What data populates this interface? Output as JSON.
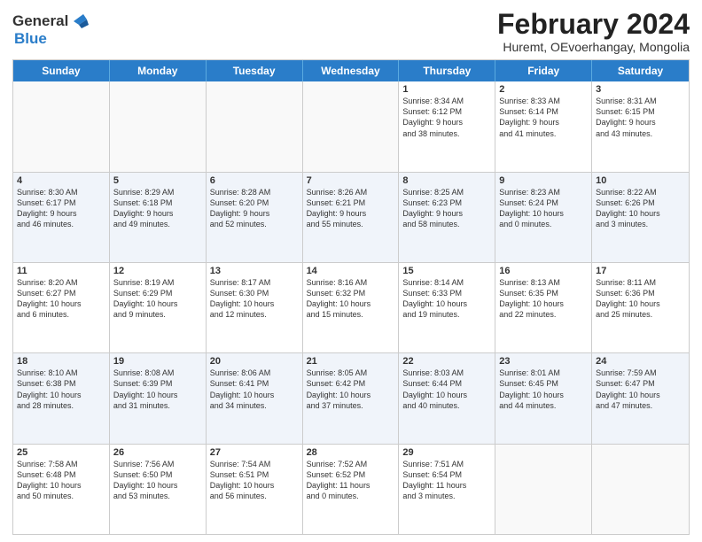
{
  "header": {
    "logo_general": "General",
    "logo_blue": "Blue",
    "main_title": "February 2024",
    "sub_title": "Huremt, OEvoerhangay, Mongolia"
  },
  "calendar": {
    "days_of_week": [
      "Sunday",
      "Monday",
      "Tuesday",
      "Wednesday",
      "Thursday",
      "Friday",
      "Saturday"
    ],
    "weeks": [
      {
        "cells": [
          {
            "day": "",
            "info": "",
            "empty": true
          },
          {
            "day": "",
            "info": "",
            "empty": true
          },
          {
            "day": "",
            "info": "",
            "empty": true
          },
          {
            "day": "",
            "info": "",
            "empty": true
          },
          {
            "day": "1",
            "info": "Sunrise: 8:34 AM\nSunset: 6:12 PM\nDaylight: 9 hours\nand 38 minutes.",
            "empty": false
          },
          {
            "day": "2",
            "info": "Sunrise: 8:33 AM\nSunset: 6:14 PM\nDaylight: 9 hours\nand 41 minutes.",
            "empty": false
          },
          {
            "day": "3",
            "info": "Sunrise: 8:31 AM\nSunset: 6:15 PM\nDaylight: 9 hours\nand 43 minutes.",
            "empty": false
          }
        ]
      },
      {
        "cells": [
          {
            "day": "4",
            "info": "Sunrise: 8:30 AM\nSunset: 6:17 PM\nDaylight: 9 hours\nand 46 minutes.",
            "empty": false
          },
          {
            "day": "5",
            "info": "Sunrise: 8:29 AM\nSunset: 6:18 PM\nDaylight: 9 hours\nand 49 minutes.",
            "empty": false
          },
          {
            "day": "6",
            "info": "Sunrise: 8:28 AM\nSunset: 6:20 PM\nDaylight: 9 hours\nand 52 minutes.",
            "empty": false
          },
          {
            "day": "7",
            "info": "Sunrise: 8:26 AM\nSunset: 6:21 PM\nDaylight: 9 hours\nand 55 minutes.",
            "empty": false
          },
          {
            "day": "8",
            "info": "Sunrise: 8:25 AM\nSunset: 6:23 PM\nDaylight: 9 hours\nand 58 minutes.",
            "empty": false
          },
          {
            "day": "9",
            "info": "Sunrise: 8:23 AM\nSunset: 6:24 PM\nDaylight: 10 hours\nand 0 minutes.",
            "empty": false
          },
          {
            "day": "10",
            "info": "Sunrise: 8:22 AM\nSunset: 6:26 PM\nDaylight: 10 hours\nand 3 minutes.",
            "empty": false
          }
        ]
      },
      {
        "cells": [
          {
            "day": "11",
            "info": "Sunrise: 8:20 AM\nSunset: 6:27 PM\nDaylight: 10 hours\nand 6 minutes.",
            "empty": false
          },
          {
            "day": "12",
            "info": "Sunrise: 8:19 AM\nSunset: 6:29 PM\nDaylight: 10 hours\nand 9 minutes.",
            "empty": false
          },
          {
            "day": "13",
            "info": "Sunrise: 8:17 AM\nSunset: 6:30 PM\nDaylight: 10 hours\nand 12 minutes.",
            "empty": false
          },
          {
            "day": "14",
            "info": "Sunrise: 8:16 AM\nSunset: 6:32 PM\nDaylight: 10 hours\nand 15 minutes.",
            "empty": false
          },
          {
            "day": "15",
            "info": "Sunrise: 8:14 AM\nSunset: 6:33 PM\nDaylight: 10 hours\nand 19 minutes.",
            "empty": false
          },
          {
            "day": "16",
            "info": "Sunrise: 8:13 AM\nSunset: 6:35 PM\nDaylight: 10 hours\nand 22 minutes.",
            "empty": false
          },
          {
            "day": "17",
            "info": "Sunrise: 8:11 AM\nSunset: 6:36 PM\nDaylight: 10 hours\nand 25 minutes.",
            "empty": false
          }
        ]
      },
      {
        "cells": [
          {
            "day": "18",
            "info": "Sunrise: 8:10 AM\nSunset: 6:38 PM\nDaylight: 10 hours\nand 28 minutes.",
            "empty": false
          },
          {
            "day": "19",
            "info": "Sunrise: 8:08 AM\nSunset: 6:39 PM\nDaylight: 10 hours\nand 31 minutes.",
            "empty": false
          },
          {
            "day": "20",
            "info": "Sunrise: 8:06 AM\nSunset: 6:41 PM\nDaylight: 10 hours\nand 34 minutes.",
            "empty": false
          },
          {
            "day": "21",
            "info": "Sunrise: 8:05 AM\nSunset: 6:42 PM\nDaylight: 10 hours\nand 37 minutes.",
            "empty": false
          },
          {
            "day": "22",
            "info": "Sunrise: 8:03 AM\nSunset: 6:44 PM\nDaylight: 10 hours\nand 40 minutes.",
            "empty": false
          },
          {
            "day": "23",
            "info": "Sunrise: 8:01 AM\nSunset: 6:45 PM\nDaylight: 10 hours\nand 44 minutes.",
            "empty": false
          },
          {
            "day": "24",
            "info": "Sunrise: 7:59 AM\nSunset: 6:47 PM\nDaylight: 10 hours\nand 47 minutes.",
            "empty": false
          }
        ]
      },
      {
        "cells": [
          {
            "day": "25",
            "info": "Sunrise: 7:58 AM\nSunset: 6:48 PM\nDaylight: 10 hours\nand 50 minutes.",
            "empty": false
          },
          {
            "day": "26",
            "info": "Sunrise: 7:56 AM\nSunset: 6:50 PM\nDaylight: 10 hours\nand 53 minutes.",
            "empty": false
          },
          {
            "day": "27",
            "info": "Sunrise: 7:54 AM\nSunset: 6:51 PM\nDaylight: 10 hours\nand 56 minutes.",
            "empty": false
          },
          {
            "day": "28",
            "info": "Sunrise: 7:52 AM\nSunset: 6:52 PM\nDaylight: 11 hours\nand 0 minutes.",
            "empty": false
          },
          {
            "day": "29",
            "info": "Sunrise: 7:51 AM\nSunset: 6:54 PM\nDaylight: 11 hours\nand 3 minutes.",
            "empty": false
          },
          {
            "day": "",
            "info": "",
            "empty": true
          },
          {
            "day": "",
            "info": "",
            "empty": true
          }
        ]
      }
    ]
  }
}
